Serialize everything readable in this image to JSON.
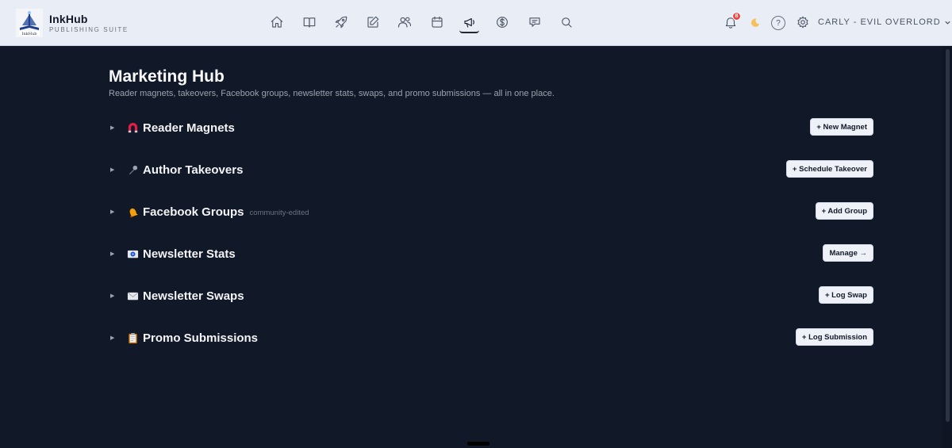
{
  "brand": {
    "name": "InkHub",
    "tagline": "PUBLISHING SUITE",
    "logo_text": "InkHub"
  },
  "nav": {
    "icons": [
      "home-icon",
      "book-icon",
      "rocket-icon",
      "pencil-icon",
      "users-icon",
      "calendar-icon",
      "megaphone-icon",
      "dollar-icon",
      "chat-icon",
      "search-icon"
    ],
    "active": "megaphone-icon",
    "notification_count": "8",
    "help_label": "?",
    "user_label": "CARLY - EVIL OVERLORD"
  },
  "page": {
    "title": "Marketing Hub",
    "subtitle": "Reader magnets, takeovers, Facebook groups, newsletter stats, swaps, and promo submissions — all in one place."
  },
  "sections": [
    {
      "icon": "magnet-icon",
      "glyph": "🧲",
      "title": "Reader Magnets",
      "note": "",
      "button": "+ New Magnet"
    },
    {
      "icon": "microphone-icon",
      "glyph": "🎤",
      "title": "Author Takeovers",
      "note": "",
      "button": "+ Schedule Takeover"
    },
    {
      "icon": "bell-icon",
      "glyph": "🔔",
      "title": "Facebook Groups",
      "note": "community-edited",
      "button": "+ Add Group"
    },
    {
      "icon": "newsletter-stats-icon",
      "glyph": "📧",
      "title": "Newsletter Stats",
      "note": "",
      "button": "Manage →"
    },
    {
      "icon": "envelope-icon",
      "glyph": "✉️",
      "title": "Newsletter Swaps",
      "note": "",
      "button": "+ Log Swap"
    },
    {
      "icon": "clipboard-icon",
      "glyph": "📋",
      "title": "Promo Submissions",
      "note": "",
      "button": "+ Log Submission"
    }
  ],
  "colors": {
    "background": "#111827",
    "topbar": "#e9edf6",
    "badge": "#ef4444",
    "button_bg": "#eef1f7"
  }
}
